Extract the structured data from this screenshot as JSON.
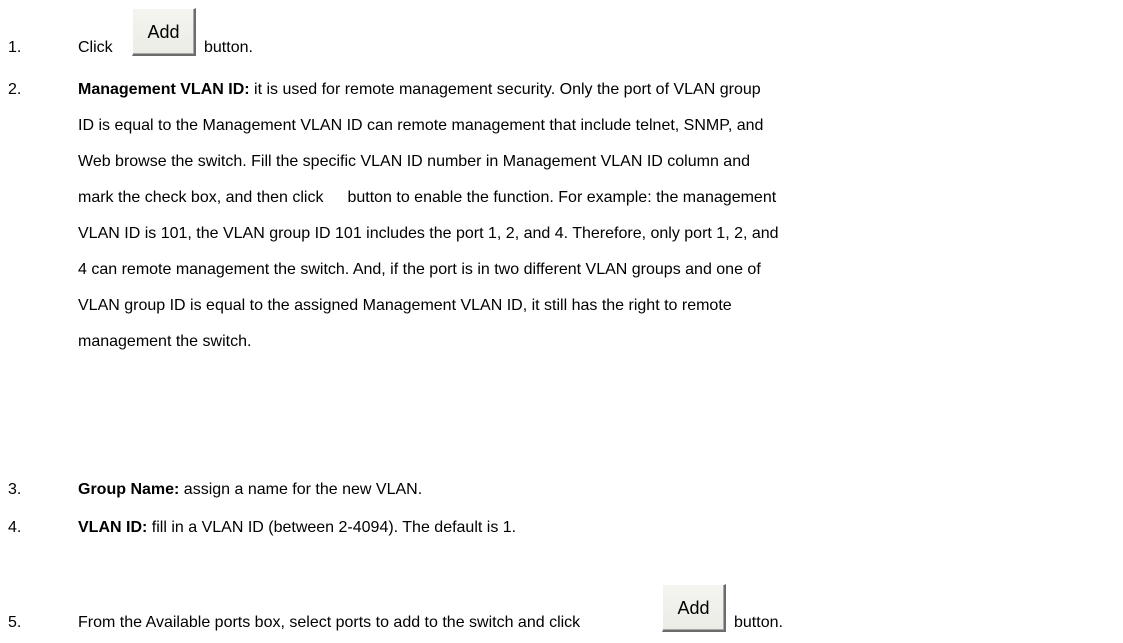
{
  "steps": [
    {
      "number": "1.",
      "before": "Click",
      "button": "Add",
      "after": "button."
    },
    {
      "number": "2.",
      "term": "Management VLAN ID:",
      "lines": [
        " it is used for remote management security. Only the port of VLAN group",
        "ID is equal to the Management VLAN ID can remote management that include telnet, SNMP, and",
        "Web browse the switch. Fill the specific VLAN ID number in Management VLAN ID column and",
        "button to enable the function. For example: the management",
        "VLAN ID is 101, the VLAN group ID 101 includes the port 1, 2, and 4. Therefore, only port 1, 2, and",
        "4 can remote management the switch. And, if the port is in two different VLAN groups and one of",
        "VLAN group ID is equal to the assigned Management VLAN ID, it still has the right to remote",
        "management the switch."
      ],
      "line4_prefix": "mark the check box, and then click"
    },
    {
      "number": "3.",
      "term": "Group Name:",
      "text": " assign a name for the new VLAN."
    },
    {
      "number": "4.",
      "term": "VLAN ID:",
      "text": " fill in a VLAN ID (between 2-4094). The default is 1."
    },
    {
      "number": "5.",
      "before": "From the Available ports box, select ports to add to the switch and click",
      "button": "Add",
      "after": "button."
    }
  ]
}
